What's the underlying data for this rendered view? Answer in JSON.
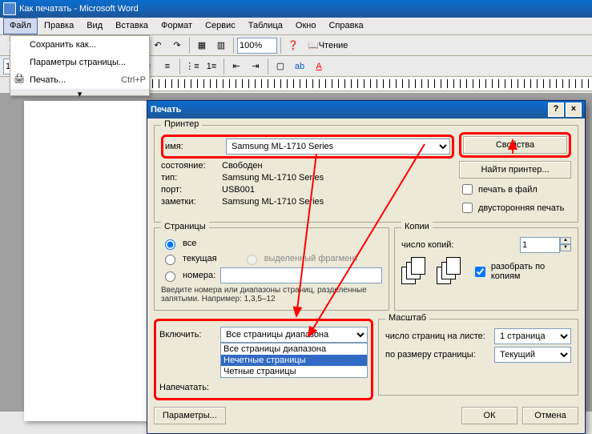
{
  "window": {
    "title": "Как печатать - Microsoft Word"
  },
  "menu": {
    "file": "Файл",
    "edit": "Правка",
    "view": "Вид",
    "insert": "Вставка",
    "format": "Формат",
    "tools": "Сервис",
    "table": "Таблица",
    "window": "Окно",
    "help": "Справка"
  },
  "file_menu": {
    "save_as": "Сохранить как...",
    "page_setup": "Параметры страницы...",
    "print": "Печать...",
    "print_sc": "Ctrl+P"
  },
  "toolbar2": {
    "fontsize": "14",
    "zoom": "100%",
    "reading": "Чтение"
  },
  "dialog": {
    "title": "Печать",
    "printer_group": "Принтер",
    "name_label": "имя:",
    "printer_name": "Samsung ML-1710 Series",
    "properties": "Свойства",
    "status_label": "состояние:",
    "status": "Свободен",
    "type_label": "тип:",
    "type": "Samsung ML-1710 Series",
    "port_label": "порт:",
    "port": "USB001",
    "notes_label": "заметки:",
    "notes": "Samsung ML-1710 Series",
    "find_printer": "Найти принтер...",
    "print_to_file": "печать в файл",
    "duplex": "двусторонняя печать",
    "pages_group": "Страницы",
    "all": "все",
    "current": "текущая",
    "selection": "выделенный фрагмент",
    "numbers": "номера:",
    "hint": "Введите номера или диапазоны страниц, разделенные запятыми. Например: 1,3,5–12",
    "copies_group": "Копии",
    "num_copies": "число копий:",
    "copies_val": "1",
    "collate": "разобрать по копиям",
    "include_label": "Включить:",
    "include_sel": "Все страницы диапазона",
    "opt1": "Все страницы диапазона",
    "opt2": "Нечетные страницы",
    "opt3": "Четные страницы",
    "print_what_label": "Напечатать:",
    "scale_group": "Масштаб",
    "pages_per_sheet": "число страниц на листе:",
    "pps_val": "1 страница",
    "scale_to": "по размеру страницы:",
    "scale_val": "Текущий",
    "params": "Параметры...",
    "ok": "ОК",
    "cancel": "Отмена"
  }
}
